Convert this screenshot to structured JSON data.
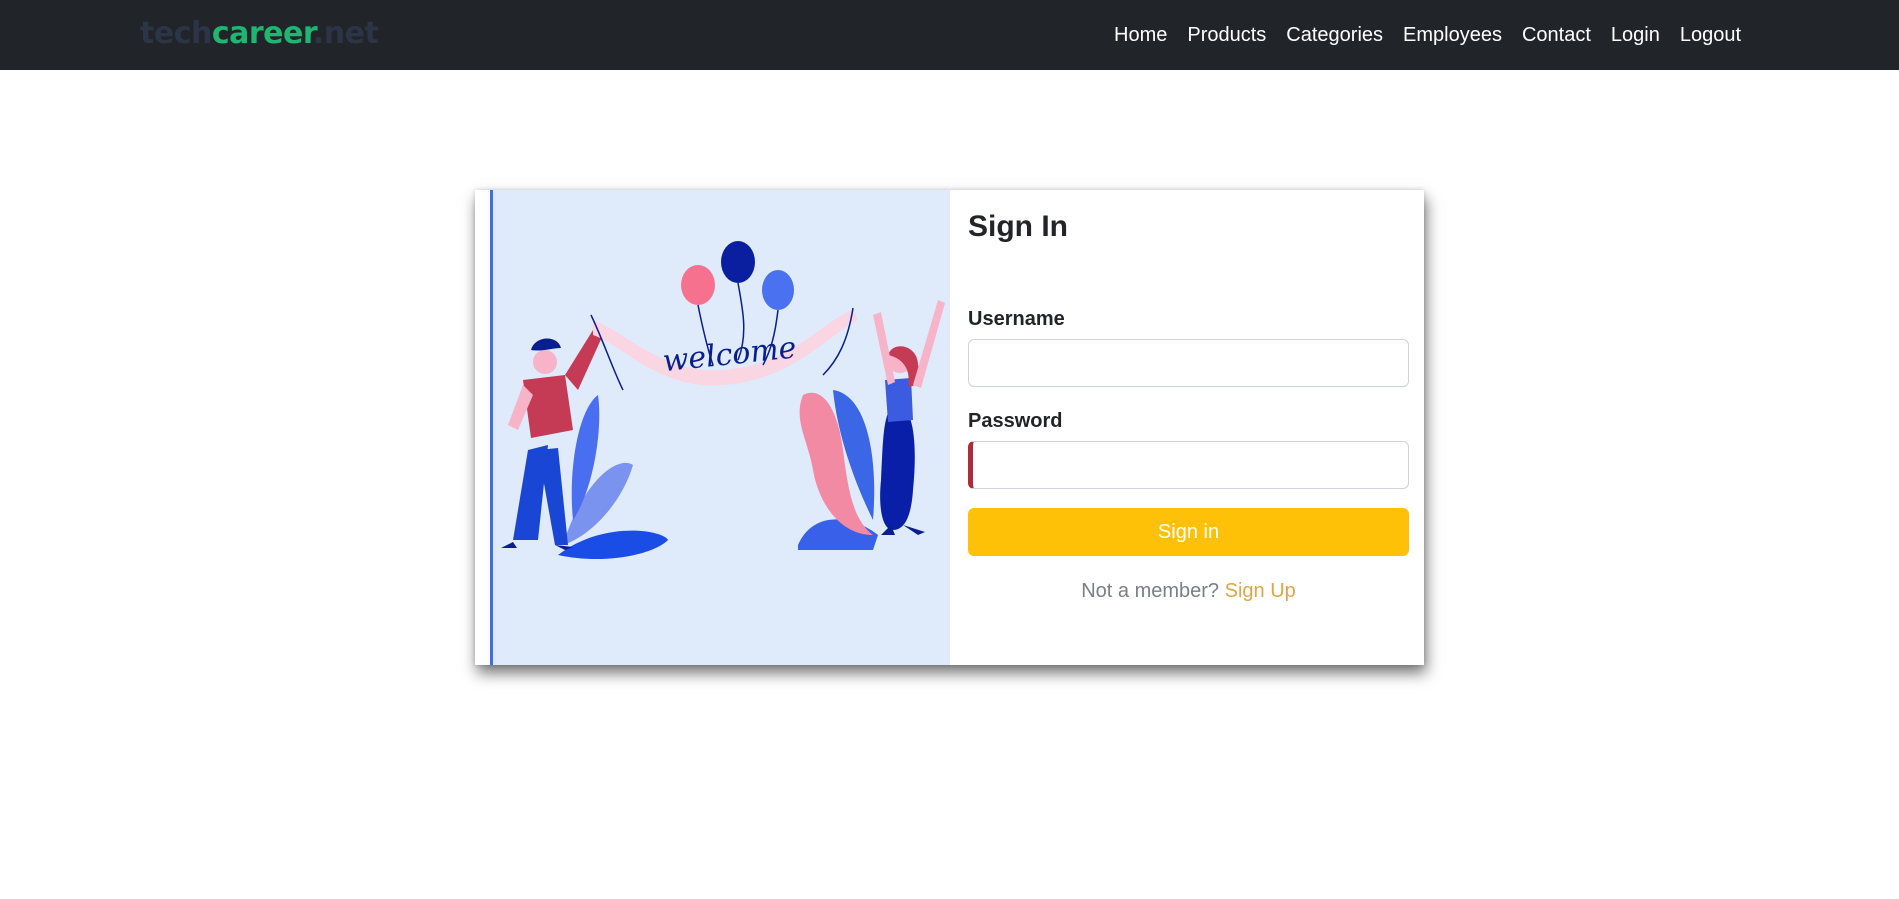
{
  "navbar": {
    "brand": {
      "part1": "tech",
      "part2": "career",
      "part3": ".net"
    },
    "links": [
      "Home",
      "Products",
      "Categories",
      "Employees",
      "Contact",
      "Login",
      "Logout"
    ]
  },
  "illustration": {
    "banner_text": "welcome"
  },
  "signin": {
    "title": "Sign In",
    "username_label": "Username",
    "username_value": "",
    "password_label": "Password",
    "password_value": "",
    "submit_label": "Sign in",
    "footer_text": "Not a member?",
    "signup_link": "Sign Up"
  },
  "colors": {
    "navbar_bg": "#212529",
    "brand_green": "#1fb672",
    "button_yellow": "#ffc107",
    "link_orange": "#e0a548",
    "illustration_bg": "#dfeafb",
    "invalid_red": "#b02a37"
  }
}
